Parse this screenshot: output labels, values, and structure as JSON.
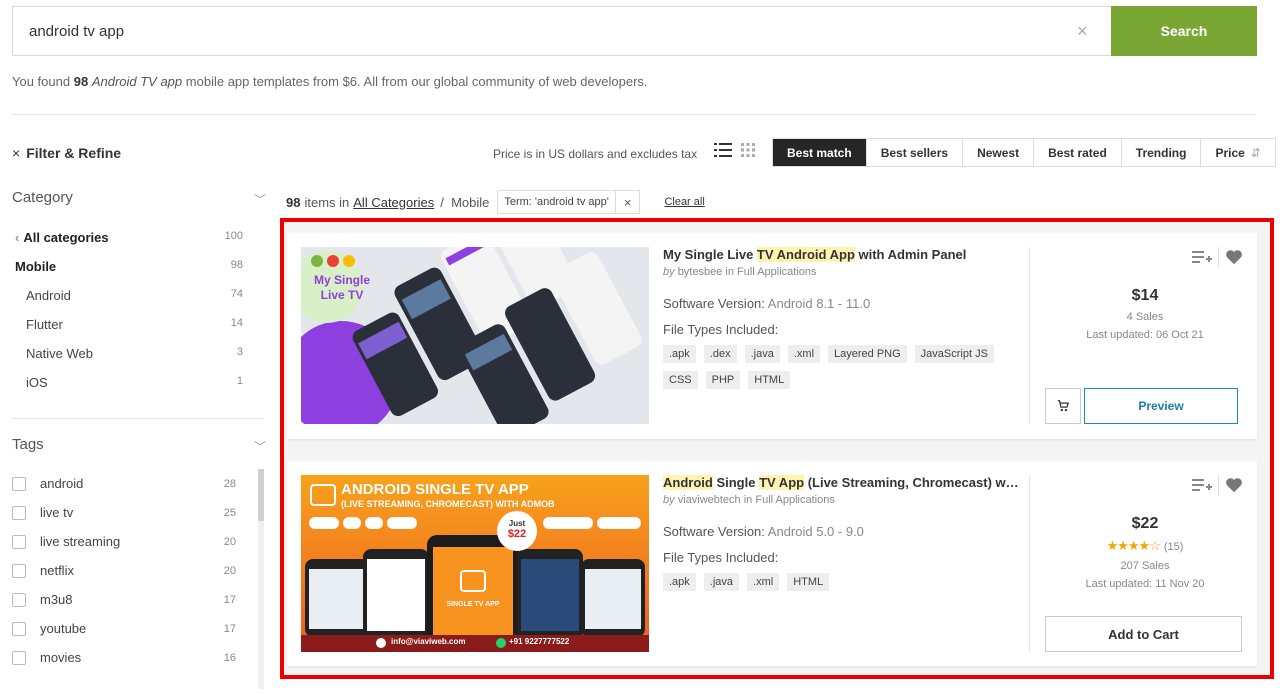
{
  "search": {
    "value": "android tv app",
    "button": "Search",
    "clear": "×"
  },
  "found": {
    "prefix": "You found",
    "count": "98",
    "term": "Android TV app",
    "suffix": "mobile app templates from $6. All from our global community of web developers."
  },
  "filter": {
    "close": "×",
    "label": "Filter & Refine"
  },
  "price_note": "Price is in US dollars and excludes tax",
  "sort": [
    {
      "label": "Best match",
      "active": true
    },
    {
      "label": "Best sellers"
    },
    {
      "label": "Newest"
    },
    {
      "label": "Best rated"
    },
    {
      "label": "Trending"
    },
    {
      "label": "Price"
    }
  ],
  "category": {
    "heading": "Category",
    "items": [
      {
        "label": "All categories",
        "count": "100"
      },
      {
        "label": "Mobile",
        "count": "98"
      },
      {
        "label": "Android",
        "count": "74"
      },
      {
        "label": "Flutter",
        "count": "14"
      },
      {
        "label": "Native Web",
        "count": "3"
      },
      {
        "label": "iOS",
        "count": "1"
      }
    ]
  },
  "tags": {
    "heading": "Tags",
    "items": [
      {
        "label": "android",
        "count": "28"
      },
      {
        "label": "live tv",
        "count": "25"
      },
      {
        "label": "live streaming",
        "count": "20"
      },
      {
        "label": "netflix",
        "count": "20"
      },
      {
        "label": "m3u8",
        "count": "17"
      },
      {
        "label": "youtube",
        "count": "17"
      },
      {
        "label": "movies",
        "count": "16"
      }
    ]
  },
  "crumbs": {
    "count": "98",
    "in": "items in",
    "all": "All Categories",
    "sep": "/",
    "current": "Mobile",
    "term": "Term: 'android tv app'",
    "term_x": "×",
    "clear": "Clear all"
  },
  "cards": [
    {
      "thumb_text": [
        "My Single",
        "Live TV"
      ],
      "title": {
        "a": "My Single Live ",
        "b": "TV Android App",
        "c": " with Admin Panel"
      },
      "by": "by",
      "author": "bytesbee",
      "in": "in Full Applications",
      "sv_label": "Software Version:",
      "sv": "Android 8.1 - 11.0",
      "ft_label": "File Types Included:",
      "chips": [
        ".apk",
        ".dex",
        ".java",
        ".xml",
        "Layered PNG",
        "JavaScript JS",
        "CSS",
        "PHP",
        "HTML"
      ],
      "price": "$14",
      "sales": "4 Sales",
      "updated": "Last updated: 06 Oct 21",
      "button": "Preview"
    },
    {
      "thumb_text": [
        "ANDROID SINGLE TV APP",
        "(LIVE STREAMING, CHROMECAST) WITH ADMOB",
        "Just",
        "$22",
        "SINGLE TV APP",
        "info@viaviweb.com",
        "+91 9227777522"
      ],
      "title": {
        "a": "Android",
        "b": " Single ",
        "c": "TV App",
        "d": " (Live Streaming, Chromecast) wi..."
      },
      "by": "by",
      "author": "viaviwebtech",
      "in": "in Full Applications",
      "sv_label": "Software Version:",
      "sv": "Android 5.0 - 9.0",
      "ft_label": "File Types Included:",
      "chips": [
        ".apk",
        ".java",
        ".xml",
        "HTML"
      ],
      "price": "$22",
      "rating": 4.5,
      "rating_count": "(15)",
      "sales": "207 Sales",
      "updated": "Last updated: 11 Nov 20",
      "button": "Add to Cart"
    }
  ],
  "colors": {
    "search_btn": "#7aa733",
    "highlight": "#ee0000",
    "preview": "#1a8fa8",
    "star": "#f0a500"
  }
}
